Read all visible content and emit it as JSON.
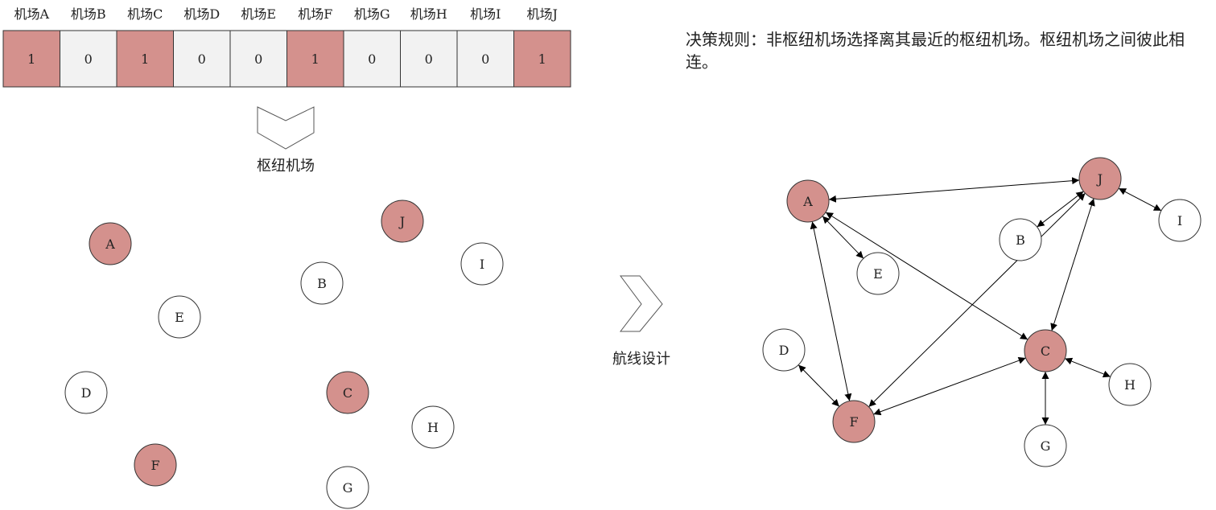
{
  "hub_color": "#d4918d",
  "nonhub_color": "#f2f2f2",
  "node_fill_hub": "#d4918d",
  "node_fill_nonhub": "#ffffff",
  "airports": [
    {
      "label": "机场A",
      "value": "1",
      "hub": true
    },
    {
      "label": "机场B",
      "value": "0",
      "hub": false
    },
    {
      "label": "机场C",
      "value": "1",
      "hub": true
    },
    {
      "label": "机场D",
      "value": "0",
      "hub": false
    },
    {
      "label": "机场E",
      "value": "0",
      "hub": false
    },
    {
      "label": "机场F",
      "value": "1",
      "hub": true
    },
    {
      "label": "机场G",
      "value": "0",
      "hub": false
    },
    {
      "label": "机场H",
      "value": "0",
      "hub": false
    },
    {
      "label": "机场I",
      "value": "0",
      "hub": false
    },
    {
      "label": "机场J",
      "value": "1",
      "hub": true
    }
  ],
  "step1_label": "枢纽机场",
  "step2_label": "航线设计",
  "rule_text": "决策规则：非枢纽机场选择离其最近的枢纽机场。枢纽机场之间彼此相连。",
  "nodes": [
    {
      "id": "A",
      "hub": true
    },
    {
      "id": "B",
      "hub": false
    },
    {
      "id": "C",
      "hub": true
    },
    {
      "id": "D",
      "hub": false
    },
    {
      "id": "E",
      "hub": false
    },
    {
      "id": "F",
      "hub": true
    },
    {
      "id": "G",
      "hub": false
    },
    {
      "id": "H",
      "hub": false
    },
    {
      "id": "I",
      "hub": false
    },
    {
      "id": "J",
      "hub": true
    }
  ],
  "edges": [
    [
      "A",
      "J"
    ],
    [
      "A",
      "E"
    ],
    [
      "A",
      "C"
    ],
    [
      "A",
      "F"
    ],
    [
      "J",
      "B"
    ],
    [
      "J",
      "I"
    ],
    [
      "J",
      "C"
    ],
    [
      "J",
      "F"
    ],
    [
      "C",
      "F"
    ],
    [
      "C",
      "H"
    ],
    [
      "C",
      "G"
    ],
    [
      "D",
      "F"
    ]
  ]
}
